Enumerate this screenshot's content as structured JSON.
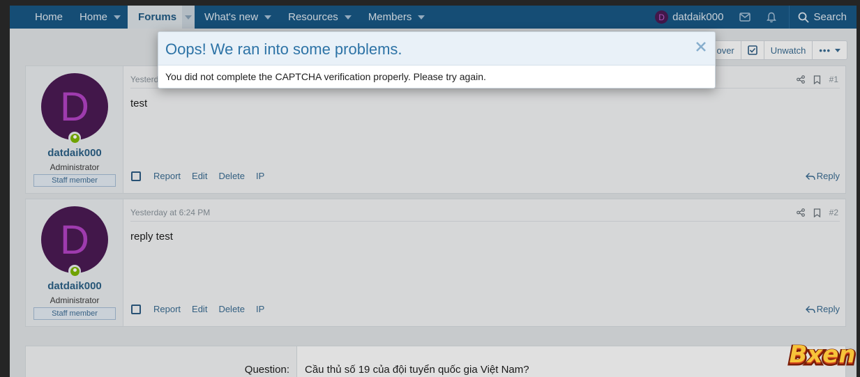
{
  "nav": {
    "items": [
      {
        "label": "Home",
        "has_caret": false
      },
      {
        "label": "Home",
        "has_caret": true
      },
      {
        "label": "Forums",
        "has_caret": true,
        "active": true
      },
      {
        "label": "What's new",
        "has_caret": true
      },
      {
        "label": "Resources",
        "has_caret": true
      },
      {
        "label": "Members",
        "has_caret": true
      }
    ],
    "user": {
      "avatar_letter": "D",
      "username": "datdaik000"
    },
    "icons": [
      "envelope-icon",
      "bell-icon"
    ],
    "search_label": "Search"
  },
  "toolbar": {
    "hover_label": "over",
    "unwatch_label": "Unwatch",
    "more_label": "•••"
  },
  "posts": [
    {
      "avatar_letter": "D",
      "username": "datdaik000",
      "user_title": "Administrator",
      "badge": "Staff member",
      "timestamp": "Yesterd",
      "number": "#1",
      "body": "test",
      "actions": {
        "report": "Report",
        "edit": "Edit",
        "delete": "Delete",
        "ip": "IP",
        "reply": "Reply"
      }
    },
    {
      "avatar_letter": "D",
      "username": "datdaik000",
      "user_title": "Administrator",
      "badge": "Staff member",
      "timestamp": "Yesterday at 6:24 PM",
      "number": "#2",
      "body": "reply test",
      "actions": {
        "report": "Report",
        "edit": "Edit",
        "delete": "Delete",
        "ip": "IP",
        "reply": "Reply"
      }
    }
  ],
  "captcha": {
    "label": "Question:",
    "question": "Cầu thủ số 19 của đội tuyển quốc gia Việt Nam?"
  },
  "modal": {
    "title": "Oops! We ran into some problems.",
    "message": "You did not complete the CAPTCHA verification properly. Please try again."
  },
  "watermark": {
    "text": "Bxen"
  },
  "colors": {
    "nav_bg": "#185886",
    "accent": "#2d73a6",
    "avatar_bg": "#4c1b55",
    "online": "#7fb900"
  }
}
